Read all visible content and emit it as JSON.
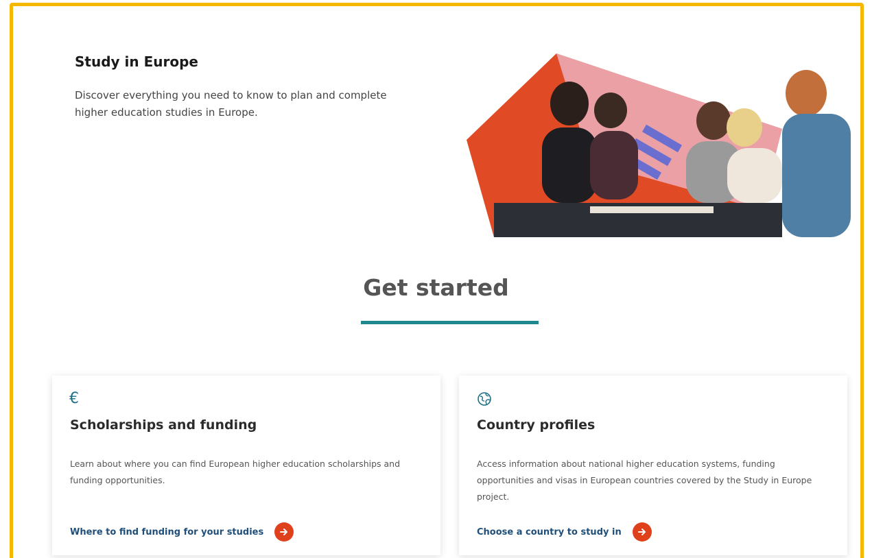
{
  "hero": {
    "title": "Study in Europe",
    "description": "Discover everything you need to know to plan and complete higher education studies in Europe."
  },
  "section": {
    "title": "Get started"
  },
  "cards": [
    {
      "icon": "euro-icon",
      "icon_glyph": "€",
      "title": "Scholarships and funding",
      "description": "Learn about where you can find European higher education scholarships and funding opportunities.",
      "link_label": "Where to find funding for your studies"
    },
    {
      "icon": "globe-icon",
      "title": "Country profiles",
      "description": "Access information about national higher education systems, funding opportunities and visas in European countries covered by the Study in Europe project.",
      "link_label": "Choose a country to study in"
    }
  ],
  "colors": {
    "frame": "#f5b800",
    "accent_teal": "#1f8790",
    "link_blue": "#1f4f7a",
    "arrow_orange": "#e0411d"
  }
}
